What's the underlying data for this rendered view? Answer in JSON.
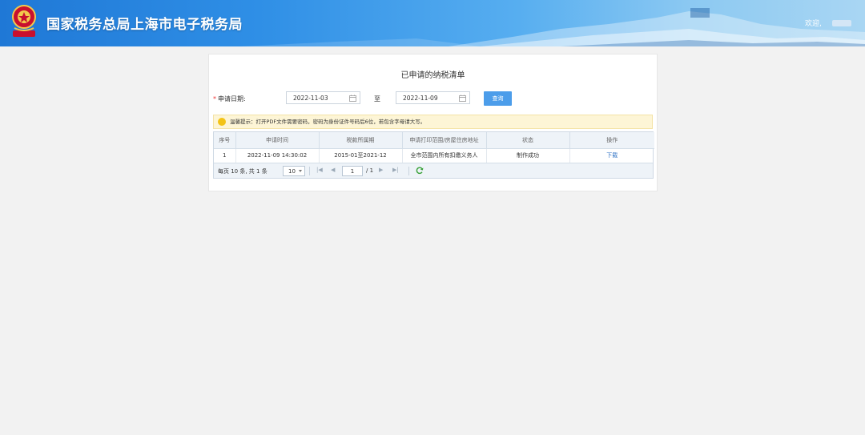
{
  "header": {
    "title": "国家税务总局上海市电子税务局",
    "welcome": "欢迎,",
    "emblem_icon": "tax-emblem-icon"
  },
  "panel": {
    "title": "已申请的纳税清单",
    "date_label": "申请日期:",
    "date_from": "2022-11-03",
    "to_label": "至",
    "date_to": "2022-11-09",
    "query_label": "查询",
    "notice": "温馨提示：打开PDF文件需要密码，密码为身份证件号码后6位，若包含字母请大写。"
  },
  "table": {
    "columns": [
      "序号",
      "申请时间",
      "税款所属期",
      "申请打印范围/房屋住房地址",
      "状态",
      "操作"
    ],
    "rows": [
      [
        "1",
        "2022-11-09 14:30:02",
        "2015-01至2021-12",
        "全市范围内所有扣缴义务人",
        "制作成功",
        "下载"
      ]
    ]
  },
  "pager": {
    "info": "每页 10 条, 共 1 条",
    "page_size": "10",
    "page": "1",
    "total_pages": "/ 1"
  },
  "colors": {
    "header_start": "#1f78d6",
    "header_end": "#a9d6f3",
    "button": "#4c9dea",
    "link": "#2f72c5",
    "notice_bg": "#fdf5d6"
  }
}
